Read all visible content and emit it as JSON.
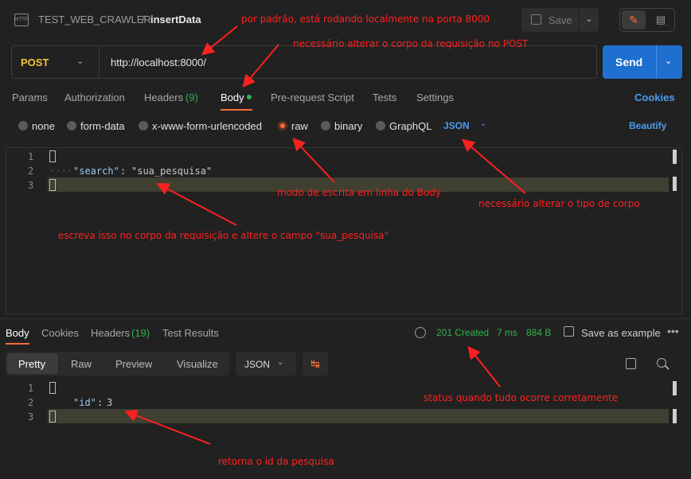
{
  "topbar": {
    "icon_label": "HTTP",
    "collection": "TEST_WEB_CRAWLER",
    "separator": "/",
    "request_name": "insertData",
    "save_label": "Save"
  },
  "request": {
    "method": "POST",
    "url": "http://localhost:8000/",
    "send_label": "Send"
  },
  "request_tabs": [
    {
      "label": "Params"
    },
    {
      "label": "Authorization"
    },
    {
      "label": "Headers",
      "count": "(9)"
    },
    {
      "label": "Body"
    },
    {
      "label": "Pre-request Script"
    },
    {
      "label": "Tests"
    },
    {
      "label": "Settings"
    }
  ],
  "cookies_label": "Cookies",
  "body_types": [
    "none",
    "form-data",
    "x-www-form-urlencoded",
    "raw",
    "binary",
    "GraphQL"
  ],
  "body_type_selected": "raw",
  "body_format": "JSON",
  "beautify_label": "Beautify",
  "request_body": {
    "line_numbers": [
      "1",
      "2",
      "3"
    ],
    "key": "\"search\"",
    "colon": ":",
    "value": "\"sua_pesquisa\""
  },
  "response_tabs": [
    {
      "label": "Body"
    },
    {
      "label": "Cookies"
    },
    {
      "label": "Headers",
      "count": "(19)"
    },
    {
      "label": "Test Results"
    }
  ],
  "response_status": {
    "status": "201 Created",
    "time": "7 ms",
    "size": "884 B",
    "save_example_label": "Save as example",
    "more": "•••"
  },
  "view_modes": [
    "Pretty",
    "Raw",
    "Preview",
    "Visualize"
  ],
  "response_format": "JSON",
  "response_body": {
    "line_numbers": [
      "1",
      "2",
      "3"
    ],
    "key": "\"id\"",
    "colon": ":",
    "value": "3"
  },
  "annotations": {
    "port": "por padrão, está rodando localmente na porta 8000",
    "post_body": "necessário alterar o corpo da requisição no POST",
    "raw_mode": "modo de escrita em linha do Body",
    "body_type": "necessário alterar o tipo de corpo",
    "write_body": "escreva isso no corpo da requisição e altere o campo \"sua_pesquisa\"",
    "status_ok": "status quando tudo ocorre corretamente",
    "returns_id": "retorna o id da pesquisa"
  },
  "colors": {
    "accent": "#ff6c37",
    "send_button": "#1f6fd1",
    "link_blue": "#4b9cf0",
    "status_green": "#2fb34a",
    "method_yellow": "#f5c33b",
    "annotation_red": "#ff2020"
  }
}
